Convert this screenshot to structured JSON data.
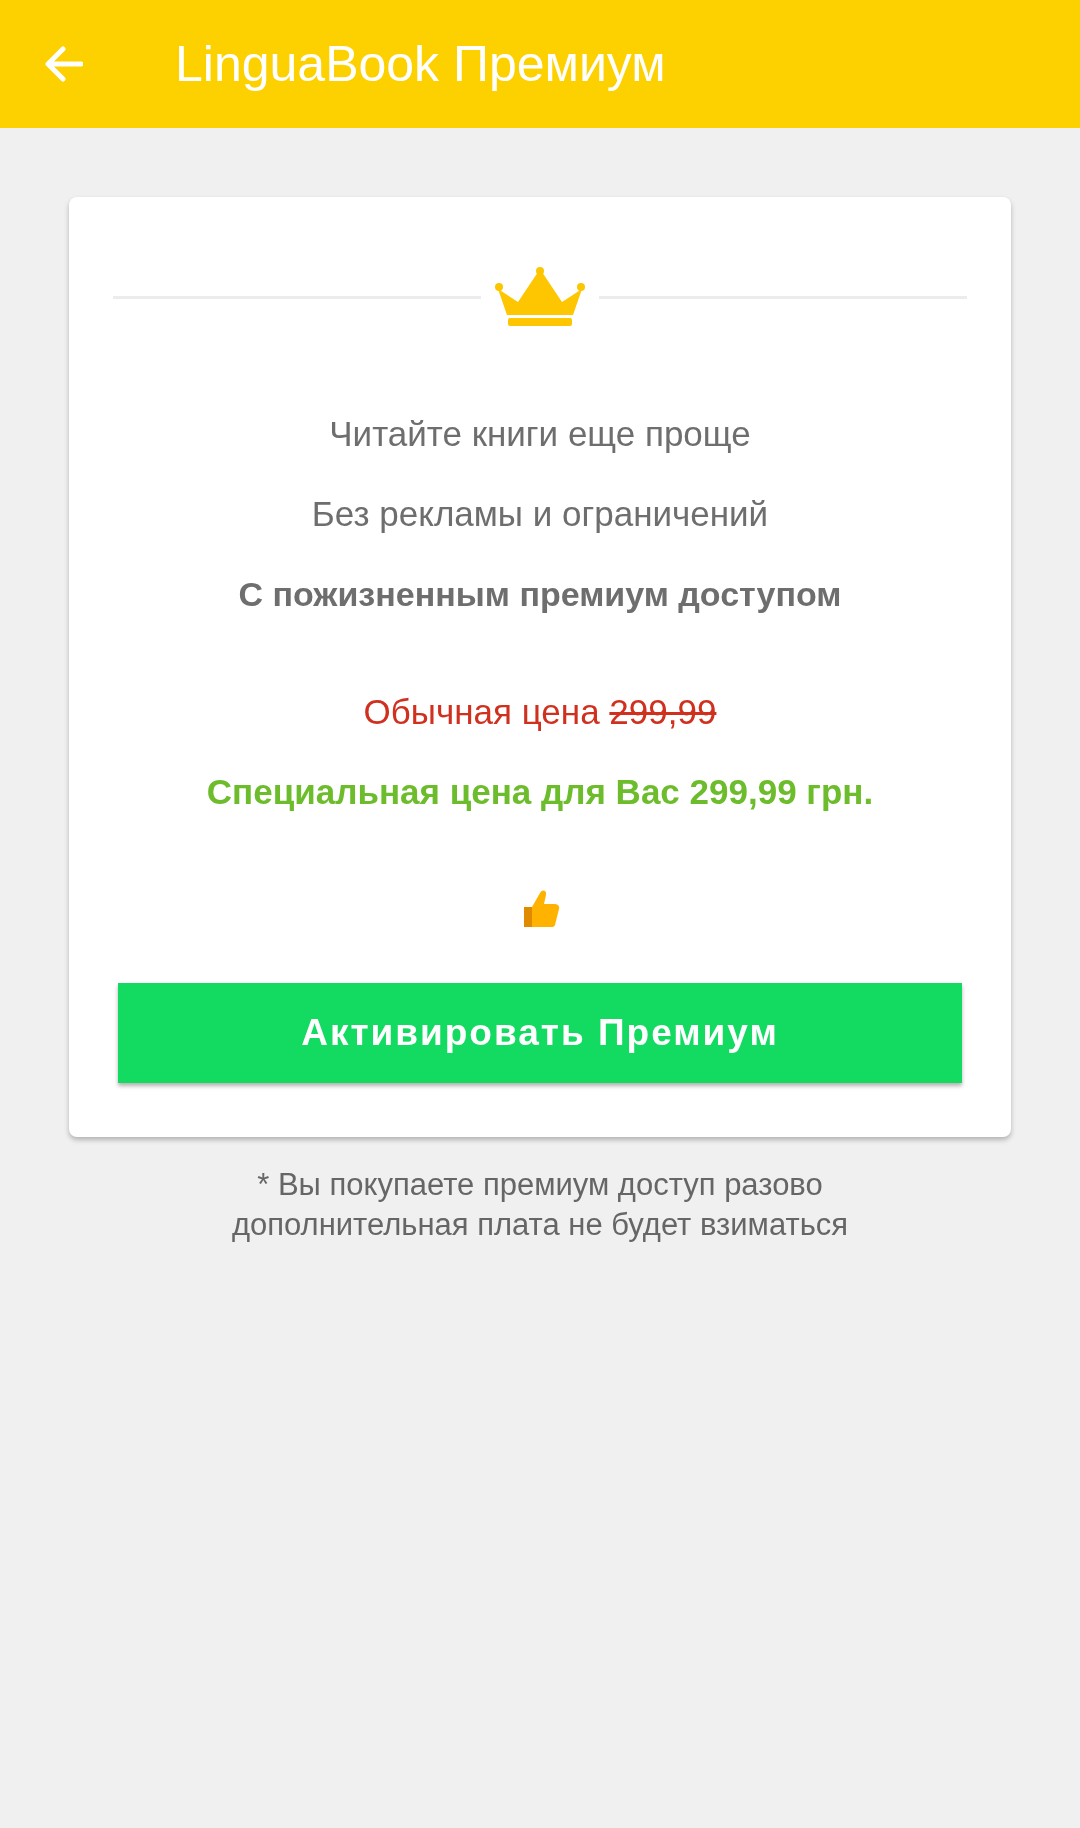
{
  "app_bar": {
    "title": "LinguaBook Премиум"
  },
  "card": {
    "features": [
      {
        "text": "Читайте книги еще проще",
        "kind": "plain"
      },
      {
        "text": "Без рекламы и ограничений",
        "kind": "plain"
      },
      {
        "text": "С пожизненным премиум доступом",
        "kind": "emphasis"
      }
    ],
    "regular_price": {
      "label": "Обычная цена",
      "old_price": "299,99"
    },
    "special_price": "Специальная цена для Вас 299,99 грн.",
    "button": "Активировать Премиум"
  },
  "footnote": [
    "* Вы покупаете премиум доступ разово",
    "дополнительная плата не будет взиматься"
  ]
}
